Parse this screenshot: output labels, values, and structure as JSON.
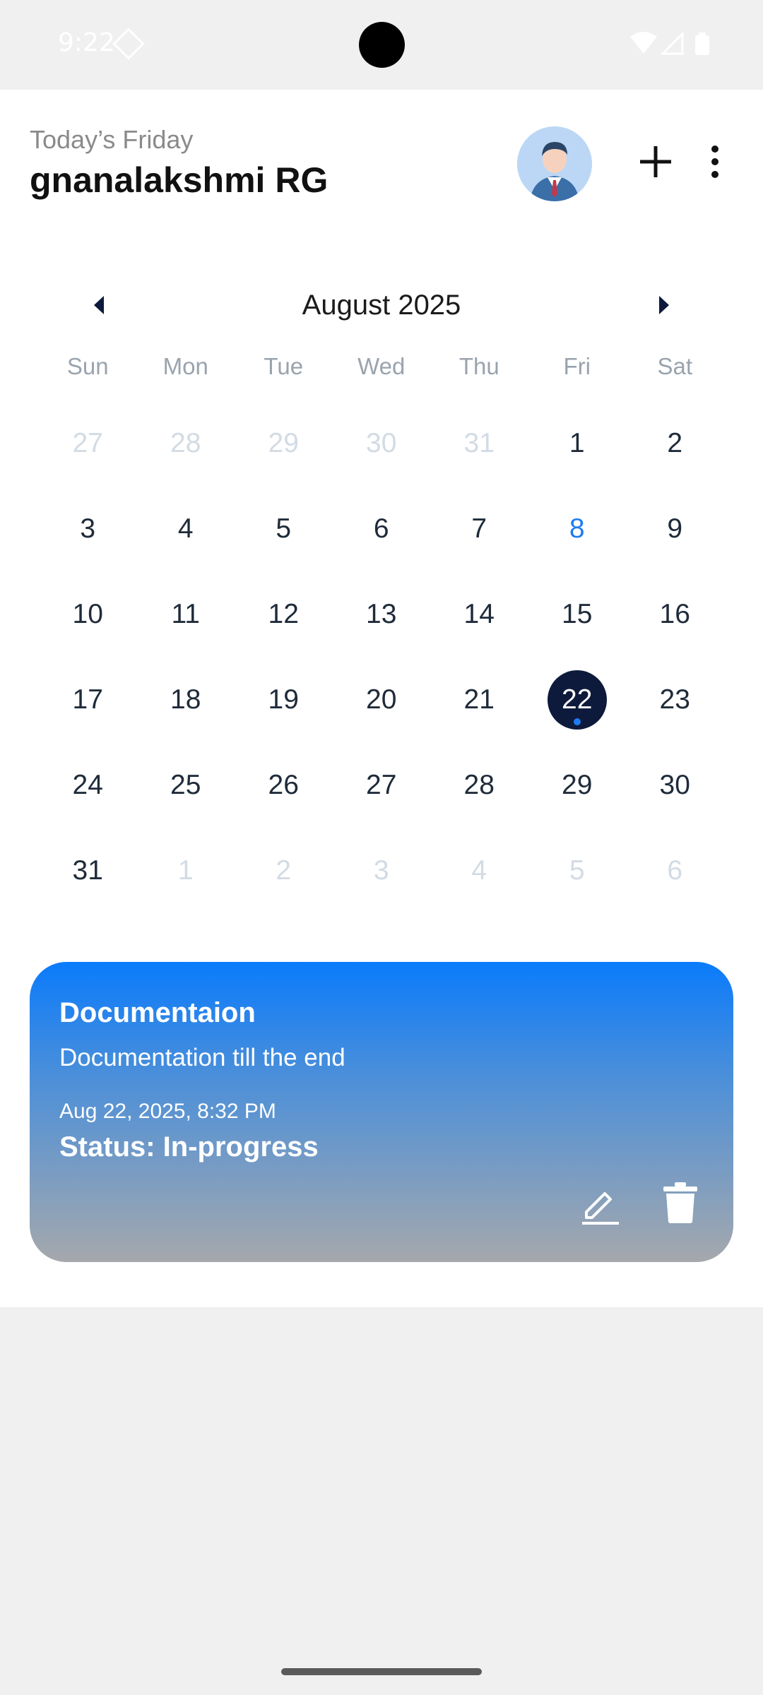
{
  "status_bar": {
    "time": "9:22"
  },
  "header": {
    "subtitle": "Today’s Friday",
    "user_name": "gnanalakshmi RG"
  },
  "calendar": {
    "month_label": "August 2025",
    "weekdays": [
      "Sun",
      "Mon",
      "Tue",
      "Wed",
      "Thu",
      "Fri",
      "Sat"
    ],
    "selected_day": "22",
    "today": "8",
    "weeks": [
      [
        {
          "d": "27",
          "m": true
        },
        {
          "d": "28",
          "m": true
        },
        {
          "d": "29",
          "m": true
        },
        {
          "d": "30",
          "m": true
        },
        {
          "d": "31",
          "m": true
        },
        {
          "d": "1"
        },
        {
          "d": "2"
        }
      ],
      [
        {
          "d": "3"
        },
        {
          "d": "4"
        },
        {
          "d": "5"
        },
        {
          "d": "6"
        },
        {
          "d": "7"
        },
        {
          "d": "8",
          "today": true
        },
        {
          "d": "9"
        }
      ],
      [
        {
          "d": "10"
        },
        {
          "d": "11"
        },
        {
          "d": "12"
        },
        {
          "d": "13"
        },
        {
          "d": "14"
        },
        {
          "d": "15"
        },
        {
          "d": "16"
        }
      ],
      [
        {
          "d": "17"
        },
        {
          "d": "18"
        },
        {
          "d": "19"
        },
        {
          "d": "20"
        },
        {
          "d": "21"
        },
        {
          "d": "22",
          "selected": true,
          "event": true
        },
        {
          "d": "23"
        }
      ],
      [
        {
          "d": "24"
        },
        {
          "d": "25"
        },
        {
          "d": "26"
        },
        {
          "d": "27"
        },
        {
          "d": "28"
        },
        {
          "d": "29"
        },
        {
          "d": "30"
        }
      ],
      [
        {
          "d": "31"
        },
        {
          "d": "1",
          "m": true
        },
        {
          "d": "2",
          "m": true
        },
        {
          "d": "3",
          "m": true
        },
        {
          "d": "4",
          "m": true
        },
        {
          "d": "5",
          "m": true
        },
        {
          "d": "6",
          "m": true
        }
      ]
    ]
  },
  "task": {
    "title": "Documentaion",
    "description": "Documentation till the end",
    "datetime": "Aug 22, 2025, 8:32 PM",
    "status": "Status: In-progress"
  },
  "colors": {
    "accent": "#1e7cf2",
    "selected_bg": "#0e1a3c",
    "card_gradient_top": "#0a7bfb",
    "card_gradient_bottom": "#a5a8ac"
  },
  "icons": [
    "wifi-icon",
    "signal-icon",
    "battery-icon",
    "plus-icon",
    "more-vert-icon",
    "chevron-left-icon",
    "chevron-right-icon",
    "edit-icon",
    "trash-icon"
  ]
}
